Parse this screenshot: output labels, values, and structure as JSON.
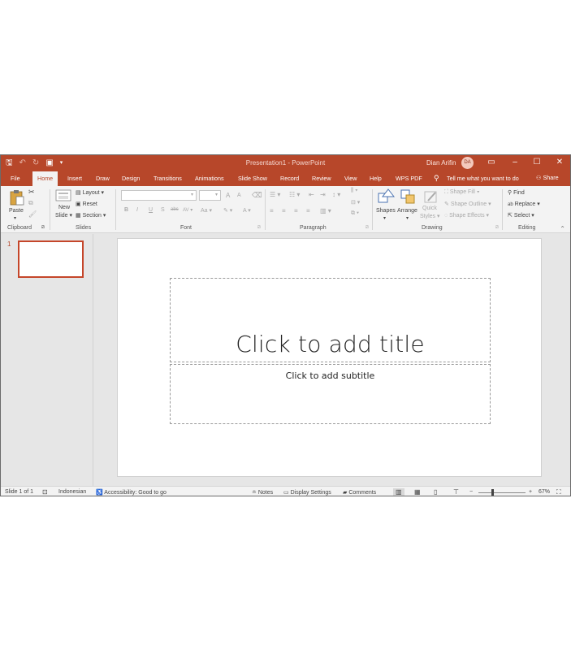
{
  "titlebar": {
    "doc_title": "Presentation1  -  PowerPoint",
    "user": "Dian Arifin",
    "avatar": "DA",
    "qat": [
      "save-icon",
      "undo-icon",
      "redo-icon",
      "start-from-beginning-icon",
      "customize-qat-icon"
    ]
  },
  "tabs": [
    {
      "label": "File"
    },
    {
      "label": "Home"
    },
    {
      "label": "Insert"
    },
    {
      "label": "Draw"
    },
    {
      "label": "Design"
    },
    {
      "label": "Transitions"
    },
    {
      "label": "Animations"
    },
    {
      "label": "Slide Show"
    },
    {
      "label": "Record"
    },
    {
      "label": "Review"
    },
    {
      "label": "View"
    },
    {
      "label": "Help"
    },
    {
      "label": "WPS PDF"
    }
  ],
  "tell_me": "Tell me what you want to do",
  "share": "Share",
  "ribbon": {
    "clipboard": {
      "label": "Clipboard",
      "paste": "Paste"
    },
    "slides": {
      "label": "Slides",
      "new_slide": "New",
      "new_slide2": "Slide",
      "layout": "Layout",
      "reset": "Reset",
      "section": "Section"
    },
    "font": {
      "label": "Font",
      "bold": "B",
      "italic": "I",
      "underline": "U",
      "shadow": "S",
      "strike": "abc",
      "spacing": "AV",
      "case": "Aa",
      "grow": "A",
      "shrink": "A",
      "color": "A"
    },
    "paragraph": {
      "label": "Paragraph"
    },
    "drawing": {
      "label": "Drawing",
      "shapes": "Shapes",
      "arrange": "Arrange",
      "quick_styles": "Quick",
      "quick_styles2": "Styles",
      "shape_fill": "Shape Fill",
      "shape_outline": "Shape Outline",
      "shape_effects": "Shape Effects"
    },
    "editing": {
      "label": "Editing",
      "find": "Find",
      "replace": "Replace",
      "select": "Select"
    }
  },
  "thumbnails": [
    {
      "number": "1"
    }
  ],
  "slide": {
    "title_placeholder": "Click to add title",
    "subtitle_placeholder": "Click to add subtitle"
  },
  "status": {
    "slide_count": "Slide 1 of 1",
    "language": "Indonesian",
    "accessibility": "Accessibility: Good to go",
    "notes": "Notes",
    "display_settings": "Display Settings",
    "comments": "Comments",
    "zoom": "67%",
    "zoom_fraction": 0.67
  },
  "colors": {
    "accent": "#b7472a",
    "ribbon": "#f3f3f3",
    "workspace": "#e6e6e6"
  }
}
